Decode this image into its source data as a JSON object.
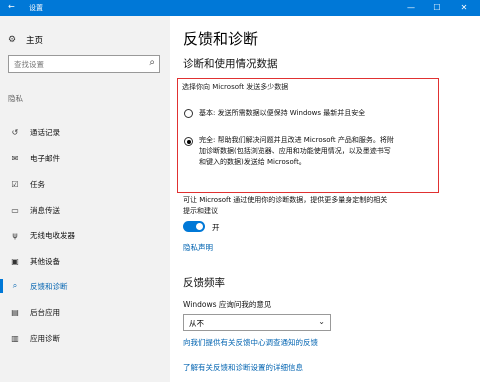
{
  "window": {
    "title": "设置",
    "minimize": "—",
    "maximize": "☐",
    "close": "✕"
  },
  "sidebar": {
    "home_label": "主页",
    "search_placeholder": "查找设置",
    "section": "隐私",
    "items": [
      {
        "label": "通话记录",
        "icon": "phone-log-icon",
        "glyph": "↺"
      },
      {
        "label": "电子邮件",
        "icon": "mail-icon",
        "glyph": "✉"
      },
      {
        "label": "任务",
        "icon": "tasks-icon",
        "glyph": "☑"
      },
      {
        "label": "消息传送",
        "icon": "message-icon",
        "glyph": "▭"
      },
      {
        "label": "无线电收发器",
        "icon": "radio-icon",
        "glyph": "ψ"
      },
      {
        "label": "其他设备",
        "icon": "devices-icon",
        "glyph": "▣"
      },
      {
        "label": "反馈和诊断",
        "icon": "feedback-icon",
        "glyph": "⌕",
        "active": true
      },
      {
        "label": "后台应用",
        "icon": "background-apps-icon",
        "glyph": "▤"
      },
      {
        "label": "应用诊断",
        "icon": "app-diagnostics-icon",
        "glyph": "▥"
      }
    ]
  },
  "main": {
    "title": "反馈和诊断",
    "section1_title": "诊断和使用情况数据",
    "question": "选择你向 Microsoft 发送多少数据",
    "option_basic": "基本: 发送所需数据以便保持 Windows 最新并且安全",
    "option_full_l1": "完全: 帮助我们解决问题并且改进 Microsoft 产品和服务。将附",
    "option_full_l2": "加诊断数据(包括浏览器、应用和功能使用情况，以及墨迹书写",
    "option_full_l3": "和键入的数据)发送给 Microsoft。",
    "tailored_l1": "可让 Microsoft 通过使用你的诊断数据，提供更多量身定制的相关",
    "tailored_l2": "提示和建议",
    "toggle_label": "开",
    "privacy_link": "隐私声明",
    "section2_title": "反馈频率",
    "frequency_label": "Windows 应询问我的意见",
    "frequency_value": "从不",
    "link1": "向我们提供有关反馈中心调查通知的反馈",
    "link2": "了解有关反馈和诊断设置的详细信息"
  }
}
